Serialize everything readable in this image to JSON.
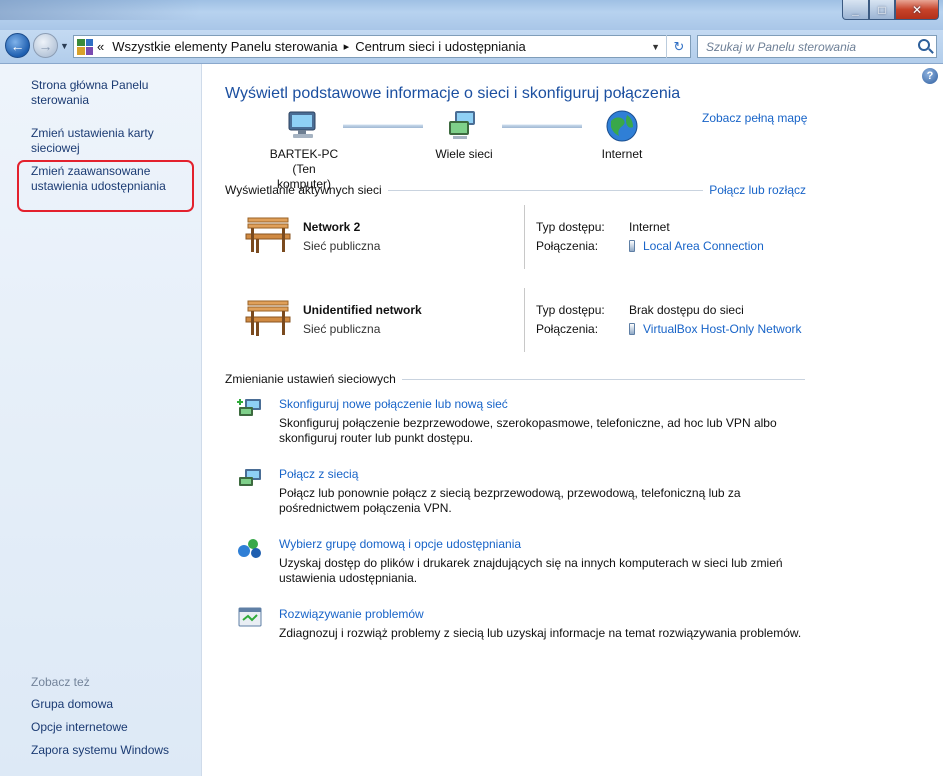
{
  "window": {
    "buttons": {
      "minimize": "_",
      "maximize": "□",
      "close": "✕"
    }
  },
  "address": {
    "overflow": "«",
    "crumbs": [
      "Wszystkie elementy Panelu sterowania",
      "Centrum sieci i udostępniania"
    ],
    "separator": "▸",
    "search_placeholder": "Szukaj w Panelu sterowania"
  },
  "sidebar": {
    "links": [
      "Strona główna Panelu sterowania",
      "Zmień ustawienia karty sieciowej",
      "Zmień zaawansowane ustawienia udostępniania"
    ],
    "see_also_label": "Zobacz też",
    "see_also": [
      "Grupa domowa",
      "Opcje internetowe",
      "Zapora systemu Windows"
    ]
  },
  "main": {
    "help": "?",
    "title": "Wyświetl podstawowe informacje o sieci i skonfiguruj połączenia",
    "full_map_link": "Zobacz pełną mapę",
    "map": {
      "computer": {
        "line1": "BARTEK-PC",
        "line2": "(Ten komputer)"
      },
      "middle": "Wiele sieci",
      "internet": "Internet"
    },
    "active": {
      "header": "Wyświetlanie aktywnych sieci",
      "connect_link": "Połącz lub rozłącz",
      "access_label": "Typ dostępu:",
      "connections_label": "Połączenia:",
      "networks": [
        {
          "name": "Network  2",
          "type": "Sieć publiczna",
          "access": "Internet",
          "connection": "Local Area Connection"
        },
        {
          "name": "Unidentified network",
          "type": "Sieć publiczna",
          "access": "Brak dostępu do sieci",
          "connection": "VirtualBox Host-Only Network"
        }
      ]
    },
    "change": {
      "header": "Zmienianie ustawień sieciowych",
      "tasks": [
        {
          "link": "Skonfiguruj nowe połączenie lub nową sieć",
          "desc1": "Skonfiguruj połączenie bezprzewodowe, szerokopasmowe, telefoniczne, ad hoc lub VPN albo",
          "desc2": "skonfiguruj router lub punkt dostępu."
        },
        {
          "link": "Połącz z siecią",
          "desc1": "Połącz lub ponownie połącz z siecią bezprzewodową, przewodową, telefoniczną lub za",
          "desc2": "pośrednictwem połączenia VPN."
        },
        {
          "link": "Wybierz grupę domową i opcje udostępniania",
          "desc1": "Uzyskaj dostęp do plików i drukarek znajdujących się na innych komputerach w sieci lub zmień",
          "desc2": "ustawienia udostępniania."
        },
        {
          "link": "Rozwiązywanie problemów",
          "desc1": "Zdiagnozuj i rozwiąż problemy z siecią lub uzyskaj informacje na temat rozwiązywania problemów.",
          "desc2": ""
        }
      ]
    }
  },
  "colors": {
    "link": "#1864c8",
    "title": "#1b4fa0",
    "highlight": "#e3212d",
    "sidebar_link": "#1b3b73"
  }
}
